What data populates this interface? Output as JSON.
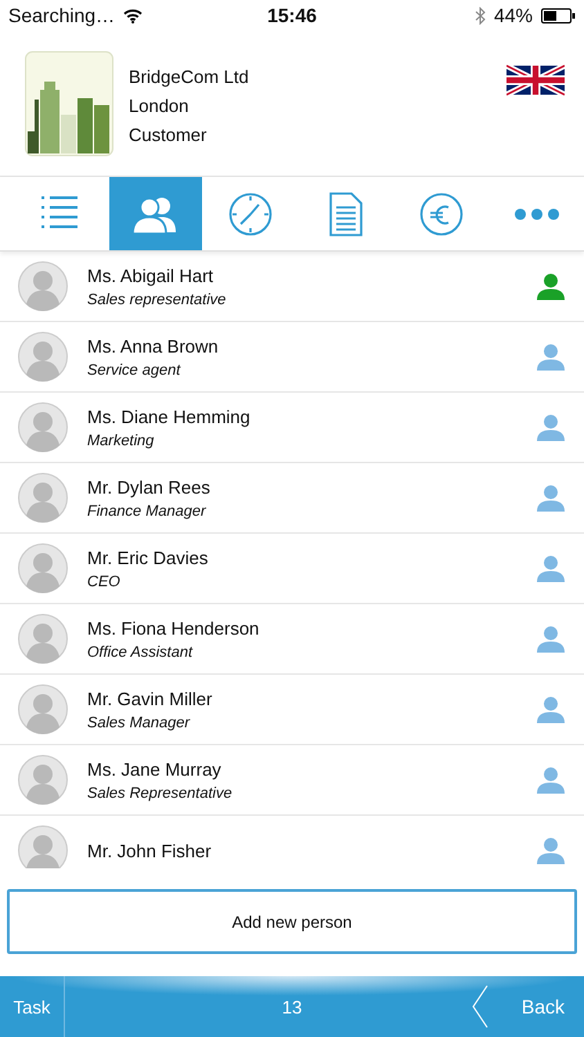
{
  "status_bar": {
    "carrier": "Searching…",
    "time": "15:46",
    "battery": "44%"
  },
  "company": {
    "name": "BridgeCom Ltd",
    "city": "London",
    "relation": "Customer"
  },
  "tabs": [
    {
      "kind": "list",
      "selected": false
    },
    {
      "kind": "people",
      "selected": true
    },
    {
      "kind": "clock",
      "selected": false
    },
    {
      "kind": "document",
      "selected": false
    },
    {
      "kind": "currency",
      "selected": false
    },
    {
      "kind": "more",
      "selected": false
    }
  ],
  "persons": [
    {
      "name": "Ms. Abigail Hart",
      "role": "Sales representative",
      "primary": true
    },
    {
      "name": "Ms. Anna Brown",
      "role": "Service agent",
      "primary": false
    },
    {
      "name": "Ms. Diane Hemming",
      "role": "Marketing",
      "primary": false
    },
    {
      "name": "Mr. Dylan Rees",
      "role": "Finance Manager",
      "primary": false
    },
    {
      "name": "Mr. Eric Davies",
      "role": "CEO",
      "primary": false
    },
    {
      "name": "Ms. Fiona Henderson",
      "role": "Office Assistant",
      "primary": false
    },
    {
      "name": "Mr. Gavin Miller",
      "role": "Sales Manager",
      "primary": false
    },
    {
      "name": "Ms. Jane Murray",
      "role": "Sales Representative",
      "primary": false
    },
    {
      "name": "Mr. John Fisher",
      "primary": false
    }
  ],
  "add_button": "Add new person",
  "bottom_bar": {
    "left": "Task",
    "count": "13",
    "back": "Back"
  }
}
